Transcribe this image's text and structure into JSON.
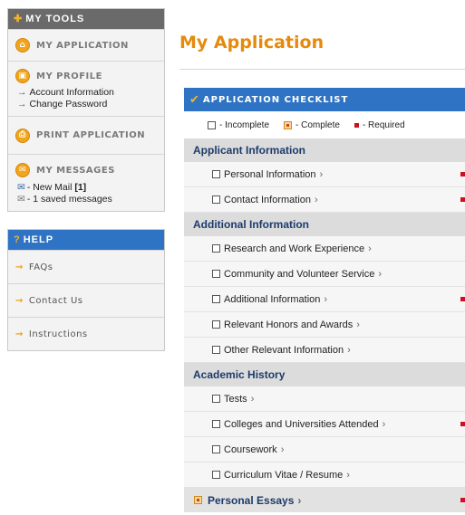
{
  "sidebar": {
    "mytools_title": "MY TOOLS",
    "my_application": "MY APPLICATION",
    "my_profile": "MY PROFILE",
    "account_information": "Account Information",
    "change_password": "Change Password",
    "print_application": "PRINT APPLICATION",
    "my_messages": "MY MESSAGES",
    "new_mail_label": "- New Mail",
    "new_mail_count": "[1]",
    "saved_messages": "- 1 saved messages",
    "help_title": "HELP",
    "faqs": "FAQs",
    "contact_us": "Contact Us",
    "instructions": "Instructions"
  },
  "main": {
    "page_title": "My Application",
    "checklist_title": "APPLICATION CHECKLIST",
    "legend": {
      "incomplete": "- Incomplete",
      "complete": "- Complete",
      "required": "- Required"
    },
    "sections": [
      {
        "title": "Applicant Information",
        "items": [
          {
            "label": "Personal Information",
            "required": true
          },
          {
            "label": "Contact Information",
            "required": true
          }
        ]
      },
      {
        "title": "Additional Information",
        "items": [
          {
            "label": "Research and Work Experience",
            "required": false
          },
          {
            "label": "Community and Volunteer Service",
            "required": false
          },
          {
            "label": "Additional Information",
            "required": true
          },
          {
            "label": "Relevant Honors and Awards",
            "required": false
          },
          {
            "label": "Other Relevant Information",
            "required": false
          }
        ]
      },
      {
        "title": "Academic History",
        "items": [
          {
            "label": "Tests",
            "required": false
          },
          {
            "label": "Colleges and Universities Attended",
            "required": true
          },
          {
            "label": "Coursework",
            "required": false
          },
          {
            "label": "Curriculum Vitae / Resume",
            "required": false
          }
        ]
      }
    ],
    "personal_essays": "Personal Essays",
    "chevron": "›"
  },
  "colors": {
    "accent_orange": "#e58a0c",
    "header_blue": "#2f74c4",
    "required_red": "#cc1122"
  }
}
